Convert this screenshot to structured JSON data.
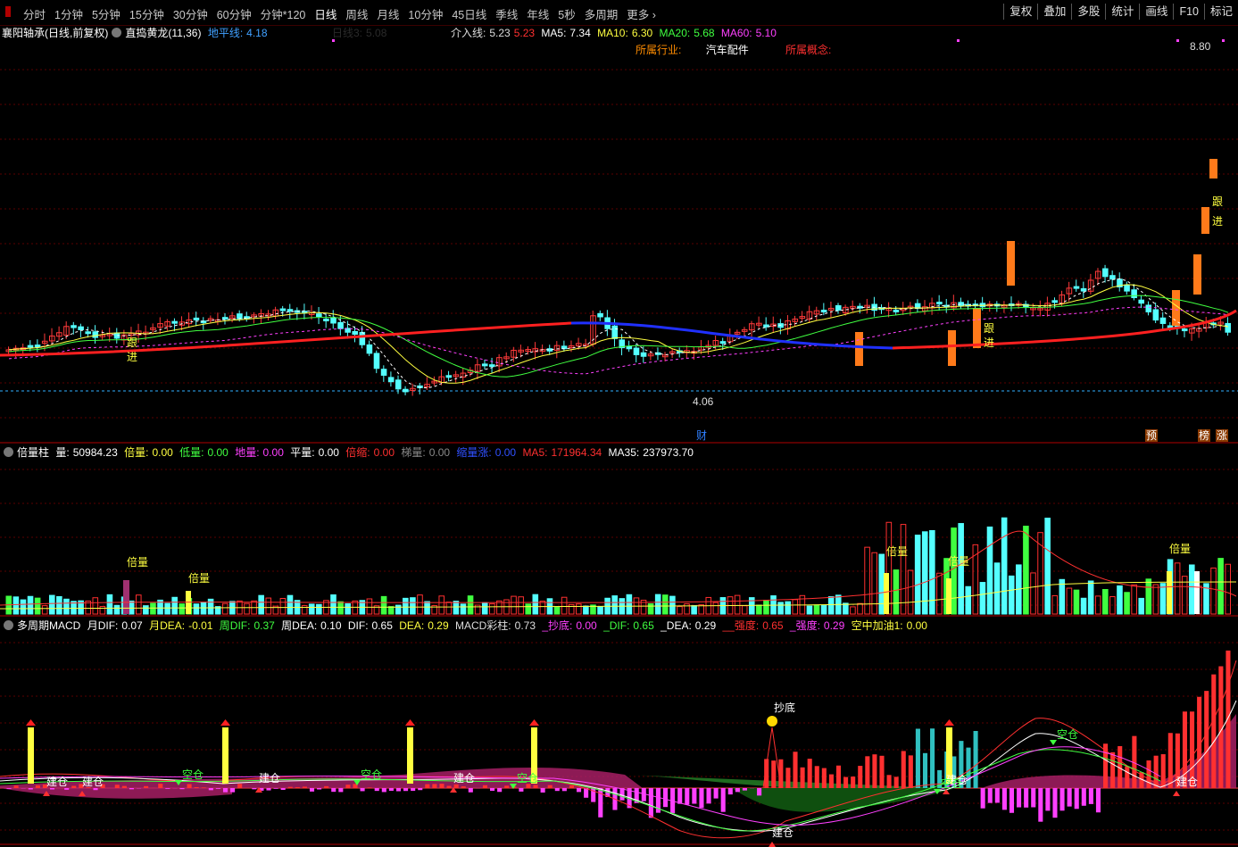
{
  "toolbar": {
    "tabs": [
      "分时",
      "1分钟",
      "5分钟",
      "15分钟",
      "30分钟",
      "60分钟",
      "分钟*120",
      "日线",
      "周线",
      "月线",
      "10分钟",
      "45日线",
      "季线",
      "年线",
      "5秒",
      "多周期",
      "更多"
    ],
    "active_tab": "日线",
    "right_buttons": [
      "复权",
      "叠加",
      "多股",
      "统计",
      "画线",
      "F10",
      "标记"
    ]
  },
  "stock_header": {
    "name": "襄阳轴承(日线,前复权)",
    "indicator": "直捣黄龙(11,36)",
    "ground_line_label": "地平线:",
    "ground_line_value": "4.18",
    "day_label": "日线3:",
    "day_value": "5.08",
    "entry_label": "介入线:",
    "entry_value": "5.23",
    "entry_value2": "5.23",
    "ma5_label": "MA5:",
    "ma5_value": "7.34",
    "ma10_label": "MA10:",
    "ma10_value": "6.30",
    "ma20_label": "MA20:",
    "ma20_value": "5.68",
    "ma60_label": "MA60:",
    "ma60_value": "5.10",
    "industry_label": "所属行业:",
    "industry_value": "汽车配件",
    "concept_label": "所属概念:",
    "price_high": "8.80",
    "price_low": "4.06",
    "signal_follow": "跟进",
    "finance_tag": "财",
    "tag_pre": "预",
    "tag_list": "榜",
    "tag_rise": "涨"
  },
  "volume_panel": {
    "title": "倍量柱",
    "vol_label": "量:",
    "vol_value": "50984.23",
    "beiliang_label": "倍量:",
    "beiliang_value": "0.00",
    "diliang_label": "低量:",
    "diliang_value": "0.00",
    "diliang2_label": "地量:",
    "diliang2_value": "0.00",
    "pingliang_label": "平量:",
    "pingliang_value": "0.00",
    "beisuo_label": "倍缩:",
    "beisuo_value": "0.00",
    "tiliang_label": "梯量:",
    "tiliang_value": "0.00",
    "suoliangzhang_label": "缩量涨:",
    "suoliangzhang_value": "0.00",
    "ma5_label": "MA5:",
    "ma5_value": "171964.34",
    "ma35_label": "MA35:",
    "ma35_value": "237973.70",
    "beiliang_marker": "倍量"
  },
  "macd_panel": {
    "title": "多周期MACD",
    "month_dif_label": "月DIF:",
    "month_dif_value": "0.07",
    "month_dea_label": "月DEA:",
    "month_dea_value": "-0.01",
    "week_dif_label": "周DIF:",
    "week_dif_value": "0.37",
    "week_dea_label": "周DEA:",
    "week_dea_value": "0.10",
    "dif_label": "DIF:",
    "dif_value": "0.65",
    "dea_label": "DEA:",
    "dea_value": "0.29",
    "macd_label": "MACD彩柱:",
    "macd_value": "0.73",
    "chaodi_label": "_抄底:",
    "chaodi_value": "0.00",
    "dif2_label": "_DIF:",
    "dif2_value": "0.65",
    "dea2_label": "_DEA:",
    "dea2_value": "0.29",
    "qiangdu_label": "__强度:",
    "qiangdu_value": "0.65",
    "qiangdu2_label": "_强度:",
    "qiangdu2_value": "0.29",
    "kongzhong_label": "空中加油1:",
    "kongzhong_value": "0.00",
    "build_label": "建仓",
    "empty_label": "空仓",
    "bottom_label": "抄底"
  },
  "colors": {
    "up": "#ff3a3a",
    "down": "#54ffff",
    "ma60": "#ff2020",
    "blue_line": "#2020ff",
    "yellow": "#ffff40",
    "green": "#40ff40",
    "magenta": "#ff40ff"
  }
}
